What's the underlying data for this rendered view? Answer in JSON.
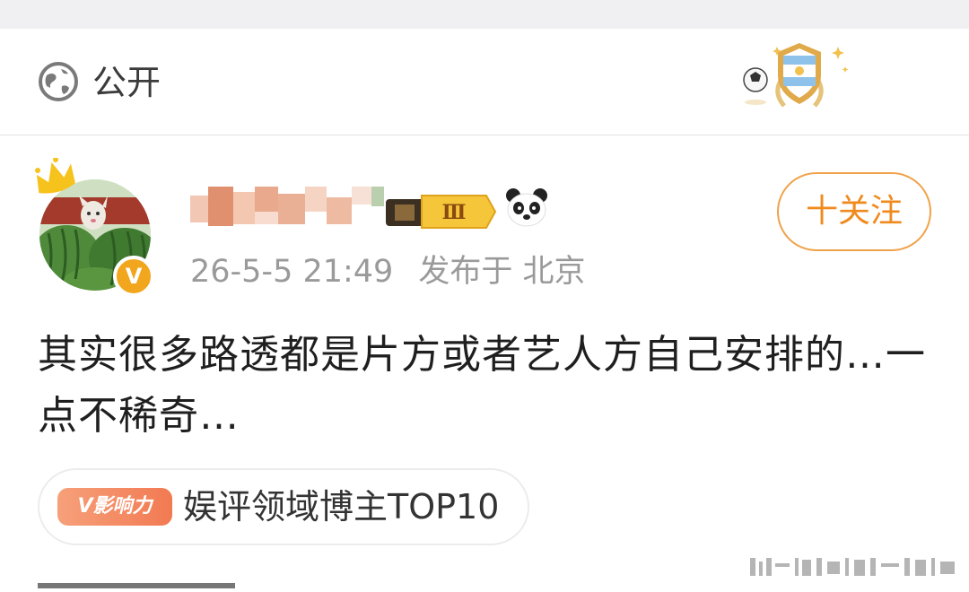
{
  "visibility": {
    "icon": "globe-icon",
    "label": "公开"
  },
  "author": {
    "avatar_icon": "watermelon-cat-avatar",
    "verified_badge": "V",
    "level_badge": "Ⅲ",
    "emoji": "panda-icon",
    "time": "26-5-5 21:49",
    "location": "发布于 北京"
  },
  "follow_button": {
    "label": "十关注"
  },
  "post": {
    "text": "其实很多路透都是片方或者艺人方自己安排的…一点不稀奇…"
  },
  "honor": {
    "tag": "V影响力",
    "label": "娱评领域博主TOP10"
  },
  "colors": {
    "accent": "#f08a1c",
    "meta": "#9a9a9a",
    "honor_tag": "#f27a52"
  }
}
